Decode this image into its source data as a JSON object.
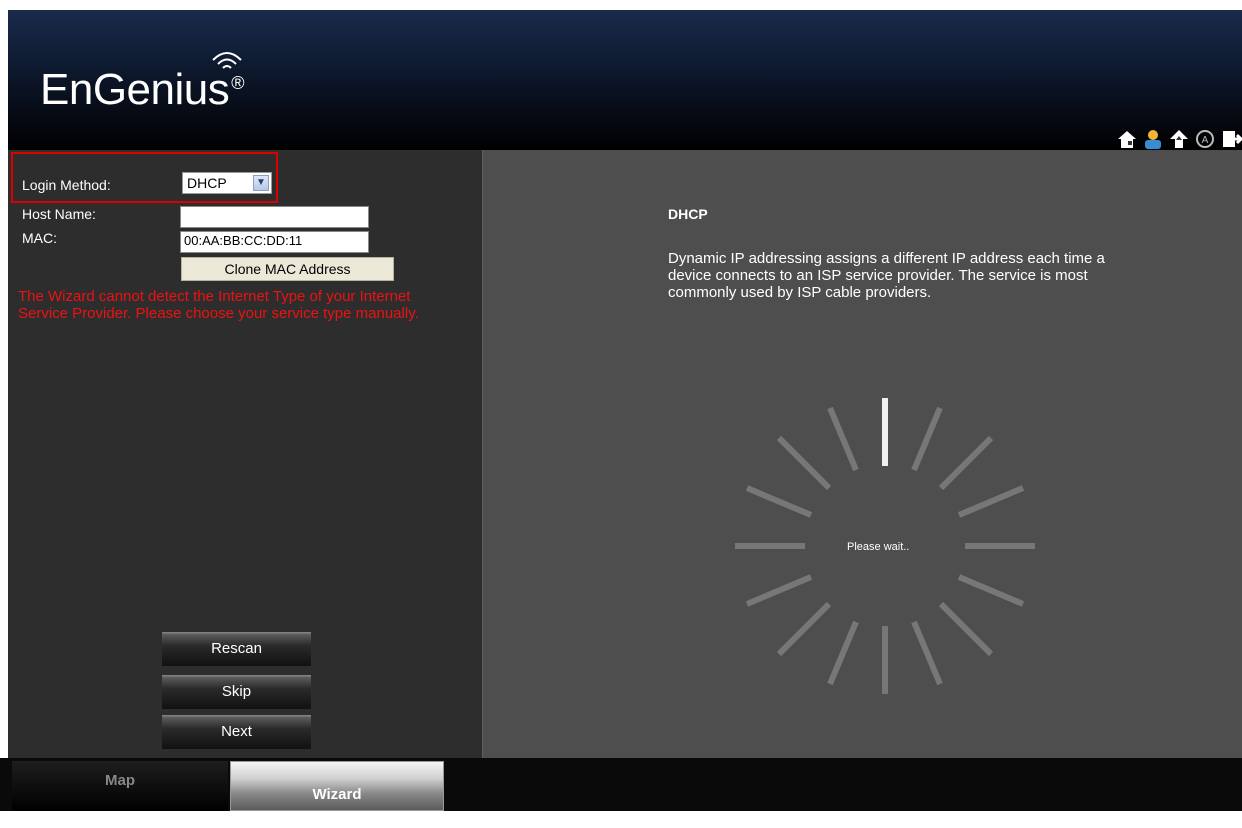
{
  "header": {
    "logo_text": "EnGenius",
    "logo_mark": "®",
    "icons": [
      "home-icon",
      "user-icon",
      "upgrade-icon",
      "auto-icon",
      "logout-icon"
    ]
  },
  "form": {
    "login_method_label": "Login Method:",
    "login_method_value": "DHCP",
    "host_name_label": "Host Name:",
    "host_name_value": "",
    "mac_label": "MAC:",
    "mac_value": "00:AA:BB:CC:DD:11",
    "clone_mac_label": "Clone MAC Address",
    "error_text": "The Wizard cannot detect the Internet Type of your Internet Service Provider. Please choose your service type manually."
  },
  "buttons": {
    "rescan": "Rescan",
    "skip": "Skip",
    "next": "Next"
  },
  "info": {
    "title": "DHCP",
    "description": "Dynamic IP addressing assigns a different IP address each time a device connects to an ISP service provider. The service is most commonly used by ISP cable providers.",
    "spinner_text": "Please wait.."
  },
  "tabs": {
    "map": "Map",
    "wizard": "Wizard"
  },
  "colors": {
    "error": "#e11111",
    "highlight_box": "#dd0000"
  }
}
